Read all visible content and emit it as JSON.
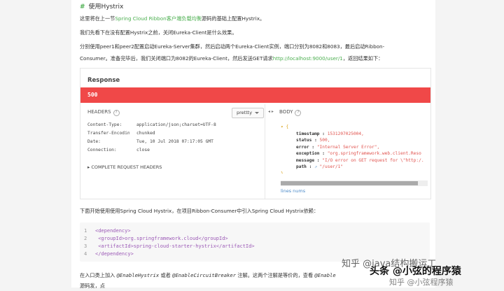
{
  "heading": {
    "hash": "#",
    "title": "使用Hystrix"
  },
  "para1": {
    "pre": "这里将在上一节",
    "link": "Spring Cloud Ribbon客户端负载均衡",
    "post": "源码的基础上配置Hystrix。"
  },
  "para2": "我们先看下在没有配置Hystrix之前，关闭Eureka-Client是什么效果。",
  "para3": {
    "line1": "分别使用peer1和peer2配置启动Eureka-Server集群，然后启动两个Eureka-Client实例，端口分别为8082和8083，最后启动Ribbon-",
    "line2_pre": "Consumer。准备完毕后，我们关闭端口为8082的Eureka-Client，然后发送GET请求",
    "line2_link": "http://localhost:9000/user/1",
    "line2_post": "，返回结果如下："
  },
  "response": {
    "title": "Response",
    "code": "500",
    "headers_label": "HEADERS",
    "help_icon": "?",
    "pretty": "prettty",
    "arrows": "◂  ▸",
    "body_label": "BODY",
    "headers": [
      {
        "k": "Content-Type:",
        "v": "application/json;charset=UTF-8"
      },
      {
        "k": "Transfer-Encodin…",
        "v": "chunked"
      },
      {
        "k": "Date:",
        "v": "Tue, 10 Jul 2018 07:17:05 GMT"
      },
      {
        "k": "Connection:",
        "v": "close"
      }
    ],
    "complete_headers": "▸ COMPLETE REQUEST HEADERS",
    "lines_nums": "lines nums",
    "json": {
      "open": "▾ {",
      "timestamp_k": "timestamp : ",
      "timestamp_v": "1531207025004,",
      "status_k": "status : ",
      "status_v": "500,",
      "error_k": "error : ",
      "error_v": "\"Internal Server Error\",",
      "exception_k": "exception : ",
      "exception_v": "\"org.springframework.web.client.Reso",
      "message_k": "message : ",
      "message_v": "\"I/O error on GET request for \\\"http:/.",
      "path_k": "path : ",
      "path_icon": "⇗",
      "path_v": "\"/user/1\"",
      "close": "}"
    }
  },
  "para4": "下面开始使用使用Spring Cloud Hystrix，在项目Ribbon-Consumer中引入Spring Cloud Hystrix依赖：",
  "code": [
    {
      "n": "1",
      "text": "<dependency>"
    },
    {
      "n": "2",
      "text": "    <groupId>org.springframework.cloud</groupId>"
    },
    {
      "n": "3",
      "text": "    <artifactId>spring-cloud-starter-hystrix</artifactId>"
    },
    {
      "n": "4",
      "text": "</dependency>"
    }
  ],
  "para5": {
    "pre": "在入口类上加入 ",
    "a1": "@EnableHystrix",
    "mid": " 或者 ",
    "a2": "@EnableCircuitBreaker",
    "post": " 注解。这两个注解是等价的，查看 ",
    "a3": "@Enable"
  },
  "para5_line2": "源码发，点",
  "watermark": {
    "l1": "知乎 @java结构搬运工",
    "l2": "头条 @小弦的程序猿",
    "l3": "知乎 @小弦程序猿"
  }
}
